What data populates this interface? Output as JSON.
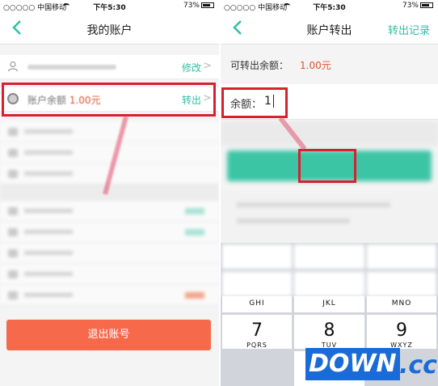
{
  "left": {
    "status": {
      "carrier": "○○○○○ 中国移动",
      "time": "下午5:30",
      "battery": "73%"
    },
    "title": "我的账户",
    "profile_action": "修改",
    "balance_label": "账户余额",
    "balance_value": "1.00元",
    "balance_action": "转出",
    "logout_label": "退出账号"
  },
  "right": {
    "status": {
      "carrier": "○○○○○ 中国移动",
      "time": "下午5:30",
      "battery": "73%"
    },
    "title": "账户转出",
    "nav_action": "转出记录",
    "available_label": "可转出余额：",
    "available_value": "1.00元",
    "amount_label": "余额：",
    "amount_value": "1",
    "keypad": [
      {
        "letters": "GHI"
      },
      {
        "letters": "JKL"
      },
      {
        "letters": "MNO"
      },
      {
        "num": "7",
        "letters": "PQRS"
      },
      {
        "num": "8",
        "letters": "TUV"
      },
      {
        "num": "9",
        "letters": "WXYZ"
      },
      {
        "num": ".",
        "letters": ""
      }
    ]
  },
  "watermark": {
    "brand": "DOWN",
    "suffix": ".cc"
  },
  "colors": {
    "accent": "#2fbfa6",
    "highlight": "#d8202f",
    "logout": "#f66a4b",
    "amount": "#e0532f"
  }
}
